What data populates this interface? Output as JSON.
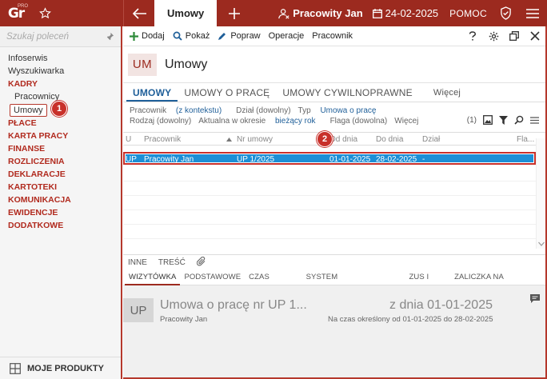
{
  "topbar": {
    "logo": "Gr",
    "logo_sup": "PRO",
    "active_tab": "Umowy",
    "user": "Pracowity Jan",
    "date": "24-02-2025",
    "help": "POMOC"
  },
  "sidebar": {
    "search_placeholder": "Szukaj poleceń",
    "items": [
      {
        "label": "Infoserwis"
      },
      {
        "label": "Wyszukiwarka"
      },
      {
        "label": "KADRY"
      },
      {
        "label": "Pracownicy"
      },
      {
        "label": "Umowy"
      },
      {
        "label": "PŁACE"
      },
      {
        "label": "KARTA PRACY"
      },
      {
        "label": "FINANSE"
      },
      {
        "label": "ROZLICZENIA"
      },
      {
        "label": "DEKLARACJE"
      },
      {
        "label": "KARTOTEKI"
      },
      {
        "label": "KOMUNIKACJA"
      },
      {
        "label": "EWIDENCJE DODATKOWE"
      }
    ],
    "bottom": "MOJE PRODUKTY"
  },
  "callouts": [
    "1",
    "2"
  ],
  "toolbar": {
    "add": "Dodaj",
    "show": "Pokaż",
    "edit": "Popraw",
    "ops": "Operacje",
    "employee": "Pracownik"
  },
  "header": {
    "badge": "UM",
    "title": "Umowy"
  },
  "tabs": [
    {
      "label": "UMOWY"
    },
    {
      "label": "UMOWY O PRACĘ"
    },
    {
      "label": "UMOWY CYWILNOPRAWNE"
    },
    {
      "label": "Więcej"
    }
  ],
  "filters": {
    "row1": {
      "pracownik_label": "Pracownik",
      "pracownik_value": "(z kontekstu)",
      "dzial": "Dział (dowolny)",
      "typ_label": "Typ",
      "typ_value": "Umowa o pracę"
    },
    "row2": {
      "rodzaj": "Rodzaj (dowolny)",
      "aktualna_label": "Aktualna w okresie",
      "aktualna_value": "bieżący rok",
      "flaga": "Flaga (dowolna)",
      "wiecej": "Więcej"
    },
    "count": "(1)"
  },
  "grid": {
    "columns": [
      "U",
      "Pracownik",
      "Nr umowy",
      "Od dnia",
      "Do dnia",
      "Dział",
      "Fla..."
    ],
    "rows": [
      {
        "u": "UP",
        "pracownik": "Pracowity Jan",
        "nr": "UP 1/2025",
        "od": "01-01-2025",
        "do": "28-02-2025",
        "dzial": "-"
      }
    ]
  },
  "lower_tabs": [
    "INNE",
    "TREŚĆ"
  ],
  "detail_tabs": [
    "WIZYTÓWKA",
    "PODSTAWOWE",
    "CZAS PRACY",
    "SYSTEM WYNAGRODZEŃ",
    "ZUS I PPK",
    "ZALICZKA NA PODATEK"
  ],
  "detail": {
    "badge": "UP",
    "title": "Umowa o pracę nr UP 1...",
    "subtitle": "Pracowity Jan",
    "date": "z dnia 01-01-2025",
    "period": "Na czas określony od 01-01-2025 do 28-02-2025"
  }
}
